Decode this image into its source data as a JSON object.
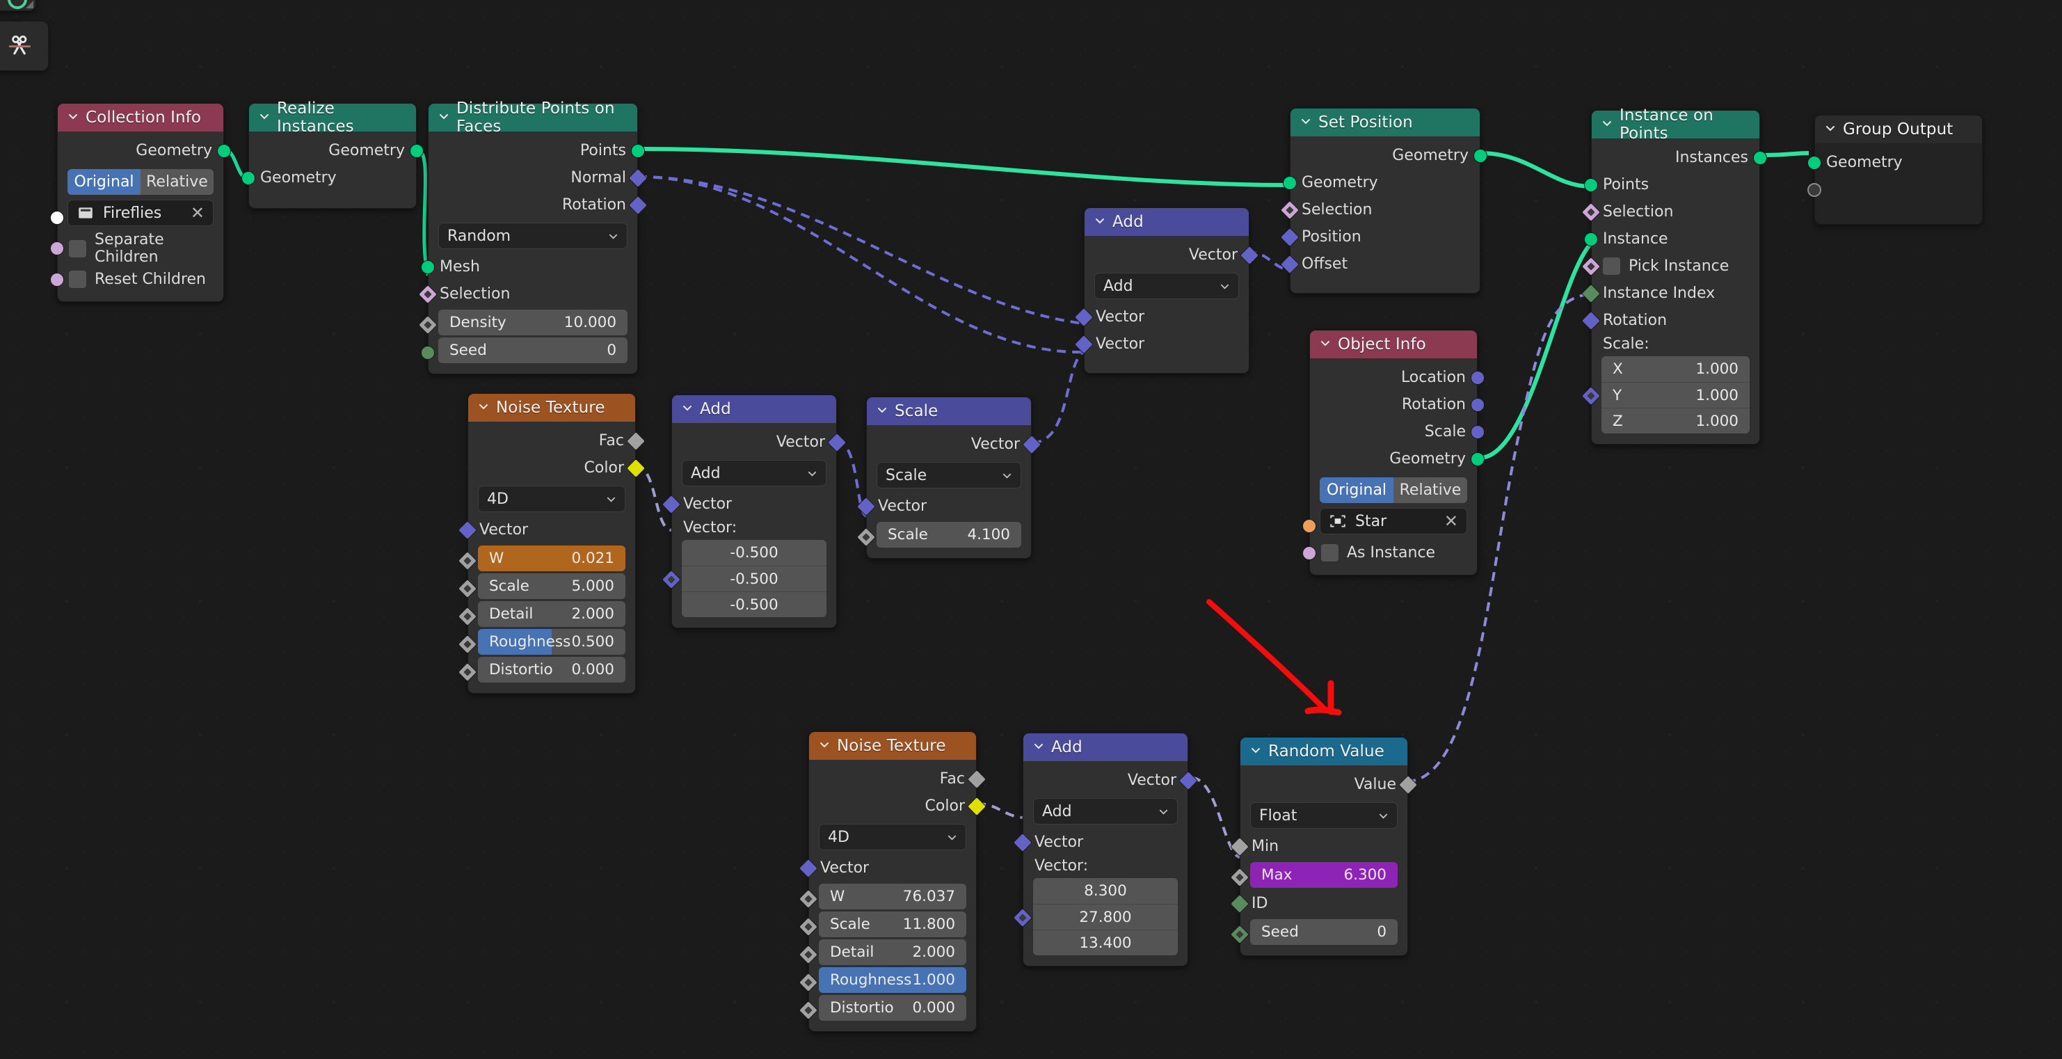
{
  "app": {
    "editor": "blender-geometry-node-editor",
    "toolbar": {
      "active_tool_icon": "scissors-cut-links-icon",
      "partial_panel_icon": "node-socket-icon"
    },
    "annotation": {
      "type": "red-arrow",
      "color": "#f40d0d"
    }
  },
  "colors": {
    "header_geometry": "#1f7562",
    "header_input": "#8b3a52",
    "header_vector": "#4b4b9c",
    "header_texture": "#9c5221",
    "header_converter": "#1b6a8e",
    "socket_geometry": "#00ce7c",
    "socket_vector": "#6363c7",
    "socket_value": "#a1a1a1",
    "socket_boolean": "#cca6d6",
    "socket_integer": "#598c5c",
    "socket_color": "#e0e000",
    "socket_object": "#ed9e5c",
    "accent_blue": "#4772b3",
    "accent_orange": "#b1661e",
    "accent_purple": "#8e24b5"
  },
  "nodes": [
    {
      "id": "collection-info",
      "title": "Collection Info",
      "outputs": [
        {
          "label": "Geometry",
          "type": "geometry"
        }
      ],
      "toggle": {
        "options": [
          "Original",
          "Relative"
        ],
        "selected": "Original"
      },
      "id_field": {
        "icon": "collection-icon",
        "value": "Fireflies",
        "clear": "✕"
      },
      "checkboxes": [
        {
          "label": "Separate Children",
          "checked": false
        },
        {
          "label": "Reset Children",
          "checked": false
        }
      ]
    },
    {
      "id": "realize-instances",
      "title": "Realize Instances",
      "outputs": [
        {
          "label": "Geometry",
          "type": "geometry"
        }
      ],
      "inputs": [
        {
          "label": "Geometry",
          "type": "geometry"
        }
      ]
    },
    {
      "id": "distribute-points-on-faces",
      "title": "Distribute Points on Faces",
      "outputs": [
        {
          "label": "Points",
          "type": "geometry"
        },
        {
          "label": "Normal",
          "type": "vector"
        },
        {
          "label": "Rotation",
          "type": "vector"
        }
      ],
      "dropdown": "Random",
      "inputs": [
        {
          "label": "Mesh",
          "type": "geometry"
        },
        {
          "label": "Selection",
          "type": "boolean"
        }
      ],
      "fields": [
        {
          "label": "Density",
          "value": "10.000",
          "type": "value"
        },
        {
          "label": "Seed",
          "value": "0",
          "type": "integer"
        }
      ]
    },
    {
      "id": "noise-texture-top",
      "title": "Noise Texture",
      "outputs": [
        {
          "label": "Fac",
          "type": "value"
        },
        {
          "label": "Color",
          "type": "color"
        }
      ],
      "dropdown": "4D",
      "inputs": [
        {
          "label": "Vector",
          "type": "vector"
        }
      ],
      "fields": [
        {
          "label": "W",
          "value": "0.021",
          "style": "orange"
        },
        {
          "label": "Scale",
          "value": "5.000",
          "style": "plain"
        },
        {
          "label": "Detail",
          "value": "2.000",
          "style": "plain"
        },
        {
          "label": "Roughness",
          "value": "0.500",
          "style": "slider",
          "fill_pct": 50
        },
        {
          "label": "Distortio",
          "value": "0.000",
          "style": "plain"
        }
      ]
    },
    {
      "id": "add-vector-mid",
      "title": "Add",
      "outputs": [
        {
          "label": "Vector",
          "type": "vector"
        }
      ],
      "dropdown": "Add",
      "inputs": [
        {
          "label": "Vector",
          "type": "vector"
        }
      ],
      "vector_label": "Vector:",
      "vector_values": [
        "-0.500",
        "-0.500",
        "-0.500"
      ]
    },
    {
      "id": "scale-vector",
      "title": "Scale",
      "outputs": [
        {
          "label": "Vector",
          "type": "vector"
        }
      ],
      "dropdown": "Scale",
      "inputs": [
        {
          "label": "Vector",
          "type": "vector"
        }
      ],
      "fields": [
        {
          "label": "Scale",
          "value": "4.100",
          "style": "plain"
        }
      ]
    },
    {
      "id": "add-vector-top",
      "title": "Add",
      "outputs": [
        {
          "label": "Vector",
          "type": "vector"
        }
      ],
      "dropdown": "Add",
      "inputs": [
        {
          "label": "Vector",
          "type": "vector"
        },
        {
          "label": "Vector",
          "type": "vector"
        }
      ]
    },
    {
      "id": "set-position",
      "title": "Set Position",
      "outputs": [
        {
          "label": "Geometry",
          "type": "geometry"
        }
      ],
      "inputs": [
        {
          "label": "Geometry",
          "type": "geometry"
        },
        {
          "label": "Selection",
          "type": "boolean"
        },
        {
          "label": "Position",
          "type": "vector"
        },
        {
          "label": "Offset",
          "type": "vector"
        }
      ]
    },
    {
      "id": "object-info",
      "title": "Object Info",
      "outputs": [
        {
          "label": "Location",
          "type": "vector"
        },
        {
          "label": "Rotation",
          "type": "vector"
        },
        {
          "label": "Scale",
          "type": "vector"
        },
        {
          "label": "Geometry",
          "type": "geometry"
        }
      ],
      "toggle": {
        "options": [
          "Original",
          "Relative"
        ],
        "selected": "Original"
      },
      "id_field": {
        "icon": "object-icon",
        "value": "Star",
        "clear": "✕"
      },
      "checkboxes": [
        {
          "label": "As Instance",
          "checked": false
        }
      ]
    },
    {
      "id": "instance-on-points",
      "title": "Instance on Points",
      "outputs": [
        {
          "label": "Instances",
          "type": "geometry"
        }
      ],
      "inputs": [
        {
          "label": "Points",
          "type": "geometry"
        },
        {
          "label": "Selection",
          "type": "boolean"
        },
        {
          "label": "Instance",
          "type": "geometry"
        }
      ],
      "checkboxes": [
        {
          "label": "Pick Instance",
          "checked": false
        }
      ],
      "inputs2": [
        {
          "label": "Instance Index",
          "type": "integer"
        },
        {
          "label": "Rotation",
          "type": "vector"
        }
      ],
      "vector_label": "Scale:",
      "scale_rows": [
        {
          "label": "X",
          "value": "1.000"
        },
        {
          "label": "Y",
          "value": "1.000"
        },
        {
          "label": "Z",
          "value": "1.000"
        }
      ]
    },
    {
      "id": "group-output",
      "title": "Group Output",
      "inputs": [
        {
          "label": "Geometry",
          "type": "geometry"
        },
        {
          "label": "",
          "type": "empty"
        }
      ]
    },
    {
      "id": "noise-texture-bottom",
      "title": "Noise Texture",
      "outputs": [
        {
          "label": "Fac",
          "type": "value"
        },
        {
          "label": "Color",
          "type": "color"
        }
      ],
      "dropdown": "4D",
      "inputs": [
        {
          "label": "Vector",
          "type": "vector"
        }
      ],
      "fields": [
        {
          "label": "W",
          "value": "76.037",
          "style": "plain"
        },
        {
          "label": "Scale",
          "value": "11.800",
          "style": "plain"
        },
        {
          "label": "Detail",
          "value": "2.000",
          "style": "plain"
        },
        {
          "label": "Roughness",
          "value": "1.000",
          "style": "fullblue"
        },
        {
          "label": "Distortio",
          "value": "0.000",
          "style": "plain"
        }
      ]
    },
    {
      "id": "add-vector-bottom",
      "title": "Add",
      "outputs": [
        {
          "label": "Vector",
          "type": "vector"
        }
      ],
      "dropdown": "Add",
      "inputs": [
        {
          "label": "Vector",
          "type": "vector"
        }
      ],
      "vector_label": "Vector:",
      "vector_values": [
        "8.300",
        "27.800",
        "13.400"
      ]
    },
    {
      "id": "random-value",
      "title": "Random Value",
      "outputs": [
        {
          "label": "Value",
          "type": "value"
        }
      ],
      "dropdown": "Float",
      "inputs": [
        {
          "label": "Min",
          "type": "value"
        }
      ],
      "fields": [
        {
          "label": "Max",
          "value": "6.300",
          "style": "purple"
        }
      ],
      "inputs2": [
        {
          "label": "ID",
          "type": "integer"
        }
      ],
      "fields2": [
        {
          "label": "Seed",
          "value": "0",
          "style": "plain"
        }
      ]
    }
  ]
}
